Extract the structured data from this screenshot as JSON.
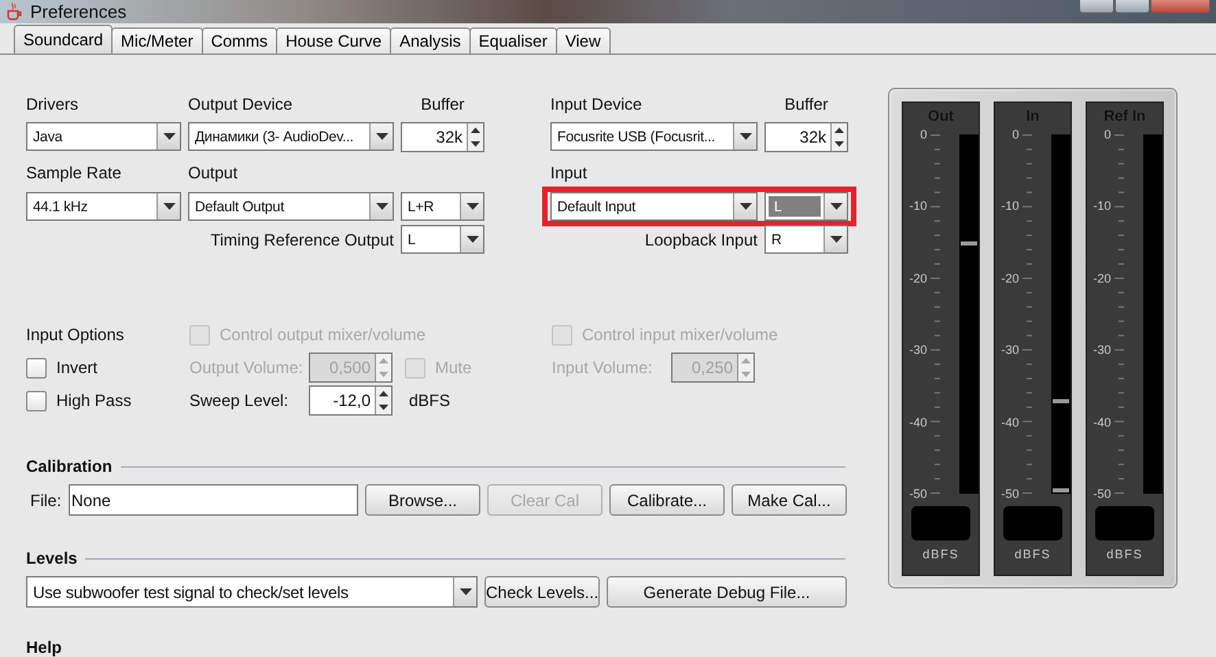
{
  "window": {
    "title": "Preferences"
  },
  "tabs": [
    {
      "label": "Soundcard",
      "selected": true
    },
    {
      "label": "Mic/Meter",
      "selected": false
    },
    {
      "label": "Comms",
      "selected": false
    },
    {
      "label": "House Curve",
      "selected": false
    },
    {
      "label": "Analysis",
      "selected": false
    },
    {
      "label": "Equaliser",
      "selected": false
    },
    {
      "label": "View",
      "selected": false
    }
  ],
  "soundcard": {
    "drivers": {
      "label": "Drivers",
      "value": "Java"
    },
    "output_device": {
      "label": "Output Device",
      "value": "Динамики (3- AudioDev..."
    },
    "output_buffer": {
      "label": "Buffer",
      "value": "32k"
    },
    "input_device": {
      "label": "Input Device",
      "value": "Focusrite USB (Focusrit..."
    },
    "input_buffer": {
      "label": "Buffer",
      "value": "32k"
    },
    "sample_rate": {
      "label": "Sample Rate",
      "value": "44.1 kHz"
    },
    "output": {
      "label": "Output",
      "value": "Default Output",
      "channel": "L+R"
    },
    "input": {
      "label": "Input",
      "value": "Default Input",
      "channel": "L",
      "channel_focused": true,
      "highlighted": true
    },
    "timing_reference_output": {
      "label": "Timing Reference Output",
      "value": "L"
    },
    "loopback_input": {
      "label": "Loopback Input",
      "value": "R"
    }
  },
  "options": {
    "input_options": {
      "label": "Input Options",
      "items": [
        {
          "label": "Invert",
          "checked": false,
          "disabled": false
        },
        {
          "label": "High Pass",
          "checked": false,
          "disabled": false
        }
      ]
    },
    "control_output": {
      "label": "Control output mixer/volume",
      "checked": false,
      "disabled": true
    },
    "output_volume": {
      "label": "Output Volume:",
      "value": "0,500",
      "disabled": true
    },
    "mute": {
      "label": "Mute",
      "checked": false,
      "disabled": true
    },
    "sweep_level": {
      "label": "Sweep Level:",
      "value": "-12,0",
      "unit": "dBFS"
    },
    "control_input": {
      "label": "Control input mixer/volume",
      "checked": false,
      "disabled": true
    },
    "input_volume": {
      "label": "Input Volume:",
      "value": "0,250",
      "disabled": true
    }
  },
  "calibration": {
    "title": "Calibration",
    "file_label": "File:",
    "file_value": "None",
    "buttons": [
      {
        "label": "Browse...",
        "disabled": false
      },
      {
        "label": "Clear Cal",
        "disabled": true
      },
      {
        "label": "Calibrate...",
        "disabled": false
      },
      {
        "label": "Make Cal...",
        "disabled": false
      }
    ]
  },
  "levels": {
    "title": "Levels",
    "signal": "Use subwoofer test signal to check/set levels",
    "buttons": [
      {
        "label": "Check Levels...",
        "disabled": false
      },
      {
        "label": "Generate Debug File...",
        "disabled": false
      }
    ]
  },
  "help": {
    "title": "Help"
  },
  "meters": [
    {
      "name": "Out",
      "scale": [
        "0",
        "-10",
        "-20",
        "-30",
        "-40",
        "-50"
      ],
      "unit": "dBFS",
      "markers": [
        {
          "level": 0.7
        }
      ]
    },
    {
      "name": "In",
      "scale": [
        "0",
        "-10",
        "-20",
        "-30",
        "-40",
        "-50"
      ],
      "unit": "dBFS",
      "markers": [
        {
          "level": 0.26
        },
        {
          "level": 0.0
        }
      ]
    },
    {
      "name": "Ref In",
      "scale": [
        "0",
        "-10",
        "-20",
        "-30",
        "-40",
        "-50"
      ],
      "unit": "dBFS"
    }
  ]
}
